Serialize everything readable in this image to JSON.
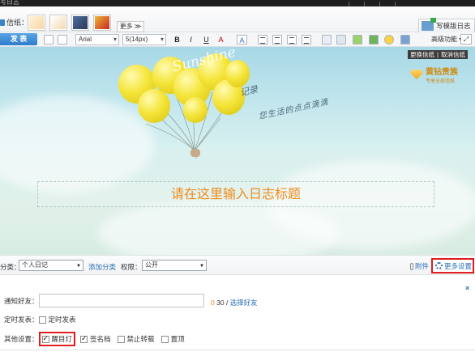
{
  "topbar": {
    "title": "写日志"
  },
  "letters": {
    "label": "信纸：",
    "more_label": "更多 ≫",
    "thumbs": [
      "#f6d7a5",
      "#f3d8b3",
      "#2d3a56",
      "#c42c1e"
    ],
    "template_button": "写模版日志"
  },
  "toolbar": {
    "publish_label": "发 表",
    "font_family": "Arial",
    "font_size": "5(14px)",
    "bold": "B",
    "italic": "I",
    "underline": "U",
    "font_color": "A",
    "highlight": "A",
    "advanced_label": "高级功能",
    "expand_icon": "expand-icon"
  },
  "canvas": {
    "sunshine_text": "Sunshine",
    "handwriting_1": "记录",
    "handwriting_2": "您生活的点点滴滴",
    "letter_tools": [
      "更换信纸",
      "取消信纸"
    ],
    "vip_title": "黄钻贵族",
    "vip_sub": "专享全部信纸",
    "title_placeholder": "请在这里输入日志标题"
  },
  "meta": {
    "category_label": "分类：",
    "category_value": "个人日记",
    "add_category": "添加分类",
    "permission_label": "权限：",
    "permission_value": "公开",
    "attach_label": "附件",
    "more_settings": "更多设置"
  },
  "settings": {
    "close_label": "×",
    "notify_label": "通知好友：",
    "notify_value": "",
    "count_prefix": "0",
    "count_total": "30",
    "choose_friends": "选择好友",
    "schedule_label": "定时发表：",
    "schedule_option": "定时发表",
    "other_label": "其他设置：",
    "options": [
      {
        "label": "醒目灯",
        "checked": true
      },
      {
        "label": "签名档",
        "checked": true
      },
      {
        "label": "禁止转载",
        "checked": false
      },
      {
        "label": "置顶",
        "checked": false
      }
    ]
  },
  "colors": {
    "accent_blue": "#2b6fb6",
    "title_orange": "#f08b1c",
    "highlight_red": "#e01c1c"
  }
}
